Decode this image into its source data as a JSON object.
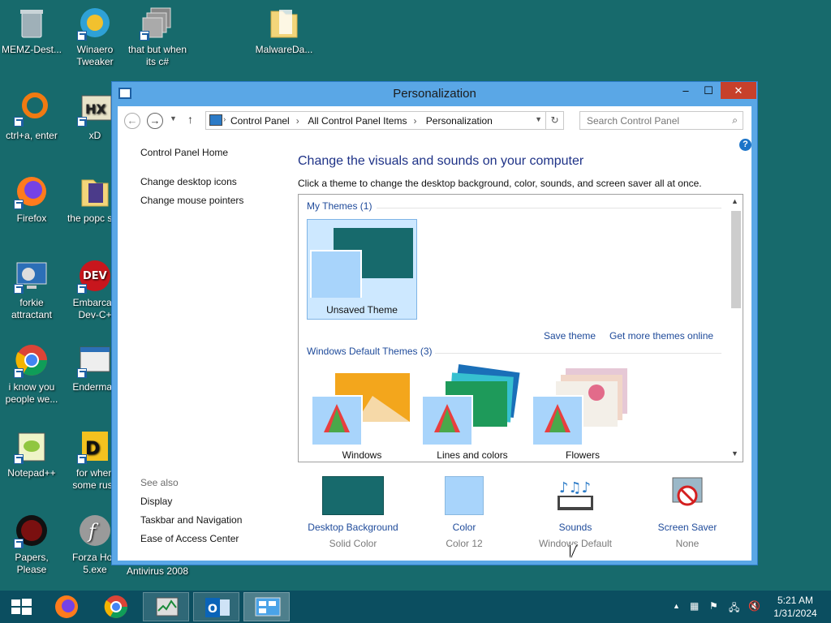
{
  "desktop": {
    "icons": [
      {
        "label": "MEMZ-Dest..."
      },
      {
        "label": "Winaero Tweaker"
      },
      {
        "label": "that but when its c#"
      },
      {
        "label": "MalwareDa..."
      },
      {
        "label": "ctrl+a, enter"
      },
      {
        "label": "xD"
      },
      {
        "label": "Firefox"
      },
      {
        "label": "the popc shit"
      },
      {
        "label": "forkie attractant"
      },
      {
        "label": "Embarcad Dev-C+"
      },
      {
        "label": "i know you people we..."
      },
      {
        "label": "Enderman"
      },
      {
        "label": "Notepad++"
      },
      {
        "label": "for when some russ"
      },
      {
        "label": "Papers, Please"
      },
      {
        "label": "Forza Hori 5.exe"
      },
      {
        "label": "Antivirus 2008"
      }
    ]
  },
  "window": {
    "title": "Personalization",
    "controls": {
      "minimize": "–",
      "maximize": "☐",
      "close": "✕"
    },
    "address": {
      "crumbs": [
        "Control Panel",
        "All Control Panel Items",
        "Personalization"
      ],
      "search_placeholder": "Search Control Panel"
    },
    "leftnav": {
      "items": [
        "Control Panel Home",
        "Change desktop icons",
        "Change mouse pointers"
      ],
      "see_also_label": "See also",
      "see_also": [
        "Display",
        "Taskbar and Navigation",
        "Ease of Access Center"
      ]
    },
    "main": {
      "heading": "Change the visuals and sounds on your computer",
      "subheading": "Click a theme to change the desktop background, color, sounds, and screen saver all at once.",
      "my_themes_label": "My Themes (1)",
      "my_themes": [
        {
          "label": "Unsaved Theme"
        }
      ],
      "save_theme": "Save theme",
      "get_more": "Get more themes online",
      "default_themes_label": "Windows Default Themes (3)",
      "default_themes": [
        {
          "label": "Windows"
        },
        {
          "label": "Lines and colors"
        },
        {
          "label": "Flowers"
        }
      ]
    },
    "bottom": [
      {
        "title": "Desktop Background",
        "value": "Solid Color"
      },
      {
        "title": "Color",
        "value": "Color 12"
      },
      {
        "title": "Sounds",
        "value": "Windows Default"
      },
      {
        "title": "Screen Saver",
        "value": "None"
      }
    ]
  },
  "taskbar": {
    "time": "5:21 AM",
    "date": "1/31/2024"
  },
  "colors": {
    "desktop": "#176a6c",
    "window_frame": "#5aa7e6",
    "close": "#c7402b",
    "theme_teal": "#176a6c",
    "color12": "#a8d4fb",
    "taskbar": "#0b4e60"
  }
}
